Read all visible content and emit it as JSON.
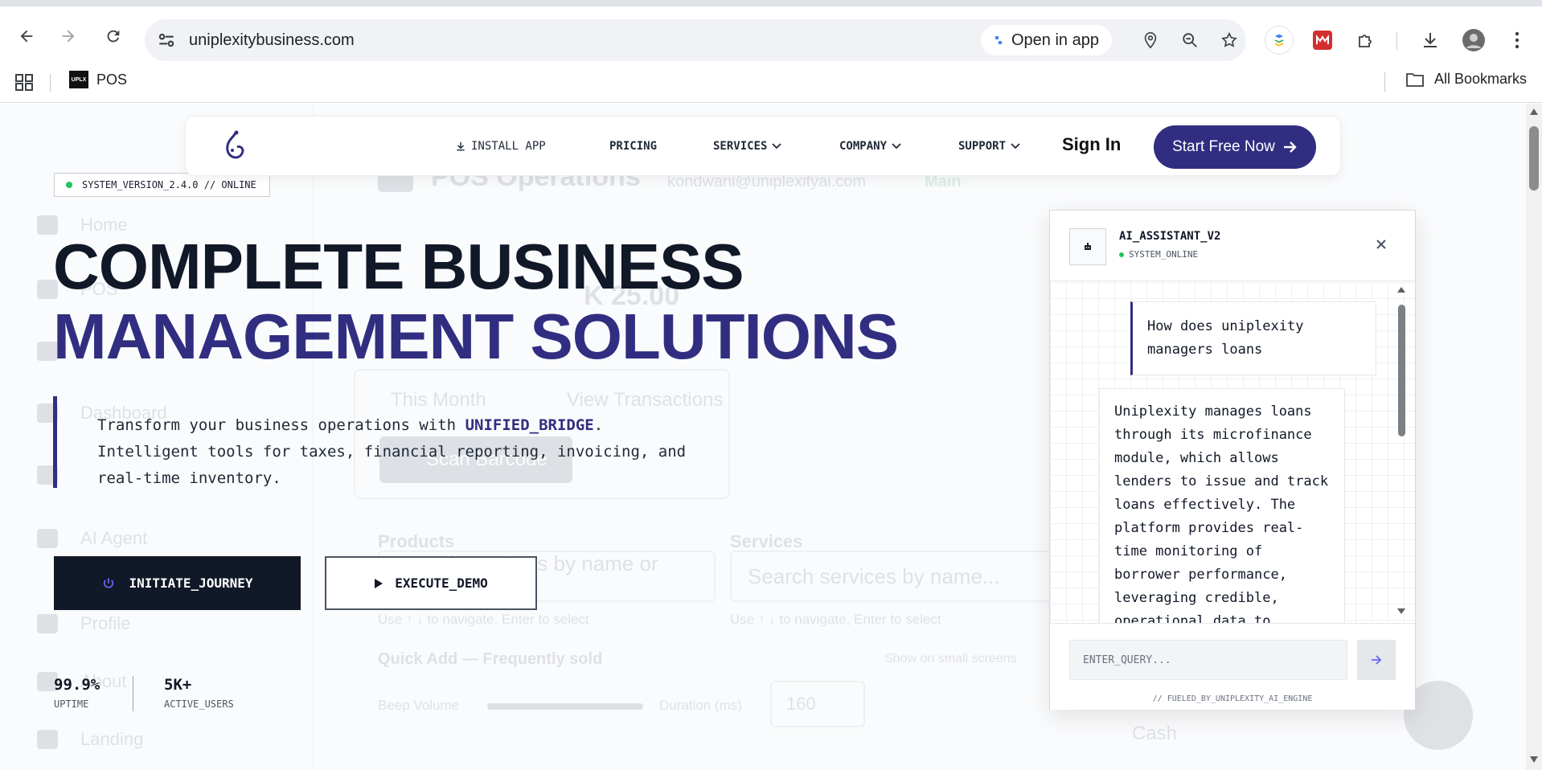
{
  "browser": {
    "url": "uniplexitybusiness.com",
    "open_in_app": "Open in app",
    "bookmarks": [
      {
        "label": "POS",
        "favicon_text": "UPLX"
      }
    ],
    "all_bookmarks": "All Bookmarks"
  },
  "background_app": {
    "title": "POS Operations",
    "email": "kondwani@uniplexityai.com",
    "branch": "Main",
    "amount": "K 25.00",
    "sidebar": [
      "Home",
      "POS",
      "",
      "Dashboard",
      "",
      "AI Agent",
      "",
      "Profile",
      "About",
      "Landing"
    ],
    "period": "This Month",
    "view_transactions": "View Transactions",
    "scan_barcode": "Scan Barcode",
    "products_label": "Products",
    "services_label": "Services",
    "products_placeholder": "Search products by name or SKU...",
    "services_placeholder": "Search services by name...",
    "nav_hint": "Use ↑ ↓ to navigate, Enter to select",
    "quick_add": "Quick Add — Frequently sold",
    "small_screens": "Show on small screens",
    "beep_volume": "Beep Volume",
    "duration": "Duration (ms)",
    "duration_value": "160",
    "payment": "Cash"
  },
  "nav": {
    "install": "INSTALL APP",
    "pricing": "PRICING",
    "services": "SERVICES",
    "company": "COMPANY",
    "support": "SUPPORT",
    "sign_in": "Sign In",
    "cta": "Start Free Now"
  },
  "hero": {
    "badge": "SYSTEM_VERSION_2.4.0 // ONLINE",
    "line1": "COMPLETE BUSINESS",
    "line2": "MANAGEMENT SOLUTIONS",
    "desc_prefix": "Transform your business operations with ",
    "desc_highlight": "UNIFIED_BRIDGE",
    "desc_suffix": ".",
    "desc_line2": "Intelligent tools for taxes, financial reporting, invoicing, and",
    "desc_line3": "real-time inventory.",
    "primary_btn": "INITIATE_JOURNEY",
    "secondary_btn": "EXECUTE_DEMO",
    "stats": [
      {
        "value": "99.9%",
        "label": "UPTIME"
      },
      {
        "value": "5K+",
        "label": "ACTIVE_USERS"
      }
    ]
  },
  "chat": {
    "title": "AI_ASSISTANT_V2",
    "status": "SYSTEM_ONLINE",
    "user_message": "How does uniplexity managers loans",
    "bot_message": "Uniplexity manages loans through its microfinance module, which allows lenders to issue and track loans effectively. The platform provides real-time monitoring of borrower performance, leveraging credible, operational data to",
    "input_placeholder": "ENTER_QUERY...",
    "footer": "// FUELED_BY_UNIPLEXITY_AI_ENGINE"
  },
  "colors": {
    "brand": "#312e81",
    "dark": "#111827",
    "online": "#22c55e"
  }
}
